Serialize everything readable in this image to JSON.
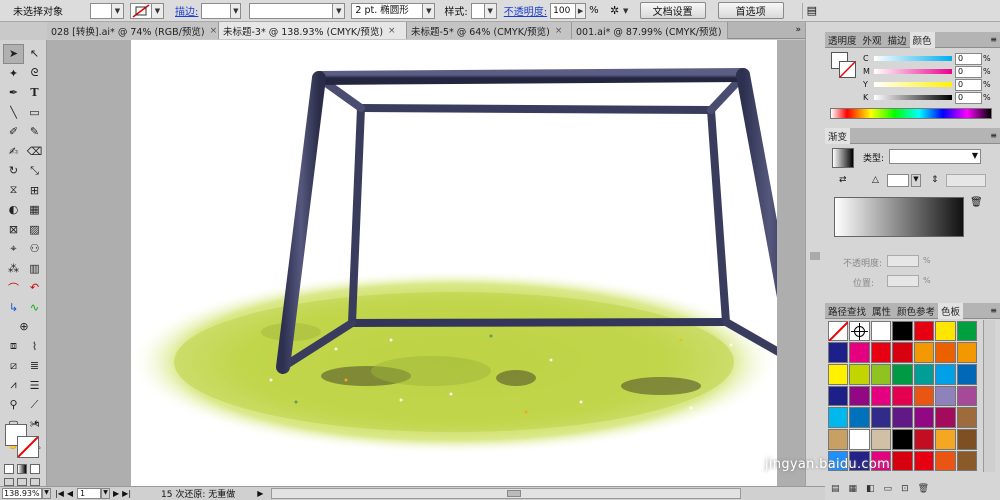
{
  "control_bar": {
    "selection_label": "未选择对象",
    "stroke_label": "描边:",
    "stroke_weight": "2 pt. 椭圆形",
    "style_label": "样式:",
    "opacity_label": "不透明度:",
    "opacity_value": "100",
    "opacity_unit": "%",
    "doc_setup_button": "文档设置",
    "preferences_button": "首选项"
  },
  "tabs": [
    {
      "label": "028 [转换].ai* @ 74% (RGB/预览)",
      "close": "×"
    },
    {
      "label": "未标题-3* @ 138.93% (CMYK/预览)",
      "close": "×"
    },
    {
      "label": "未标题-5* @ 64% (CMYK/预览)",
      "close": "×"
    },
    {
      "label": "001.ai* @ 87.99% (CMYK/预览)",
      "close": "×"
    }
  ],
  "color_panel": {
    "tabs": [
      "透明度",
      "外观",
      "描边",
      "颜色"
    ],
    "channels": [
      {
        "label": "C",
        "value": "0",
        "unit": "%"
      },
      {
        "label": "M",
        "value": "0",
        "unit": "%"
      },
      {
        "label": "Y",
        "value": "0",
        "unit": "%"
      },
      {
        "label": "K",
        "value": "0",
        "unit": "%"
      }
    ]
  },
  "gradient_panel": {
    "tab": "渐变",
    "type_label": "类型:",
    "opacity_label": "不透明度:",
    "position_label": "位置:",
    "pct": "%"
  },
  "swatch_panel": {
    "tabs": [
      "路径查找",
      "属性",
      "颜色参考",
      "色板"
    ],
    "swatches": [
      "none",
      "registration",
      "#ffffff",
      "#000000",
      "#e60012",
      "#ffe600",
      "#00a040",
      "#1d2088",
      "#e4007f",
      "#e60012",
      "#d7000f",
      "#f39800",
      "#eb6100",
      "#f39800",
      "#fff100",
      "#c2d500",
      "#8fc31f",
      "#009944",
      "#009e96",
      "#00a0e9",
      "#0068b7",
      "#1d2088",
      "#920783",
      "#e4007f",
      "#e5004f",
      "#ea5514",
      "#8f82bc",
      "#a64a97",
      "#00b7ee",
      "#0072bc",
      "#312b8a",
      "#601986",
      "#920783",
      "#a40b5d",
      "#9e6b3c",
      "#c9a063",
      "#ffffff",
      "#d1c0a5",
      "#000000",
      "#c30d23",
      "#f5a623",
      "#7d4f22",
      "#1e90ff",
      "#222288",
      "#e4007f",
      "#d7000f",
      "#e60012",
      "#ea5514",
      "#8b5a2b"
    ]
  },
  "status_bar": {
    "zoom": "138.93%",
    "page": "1",
    "status": "15 次还原: 无重做"
  },
  "watermark": "jingyan.baidu.com"
}
